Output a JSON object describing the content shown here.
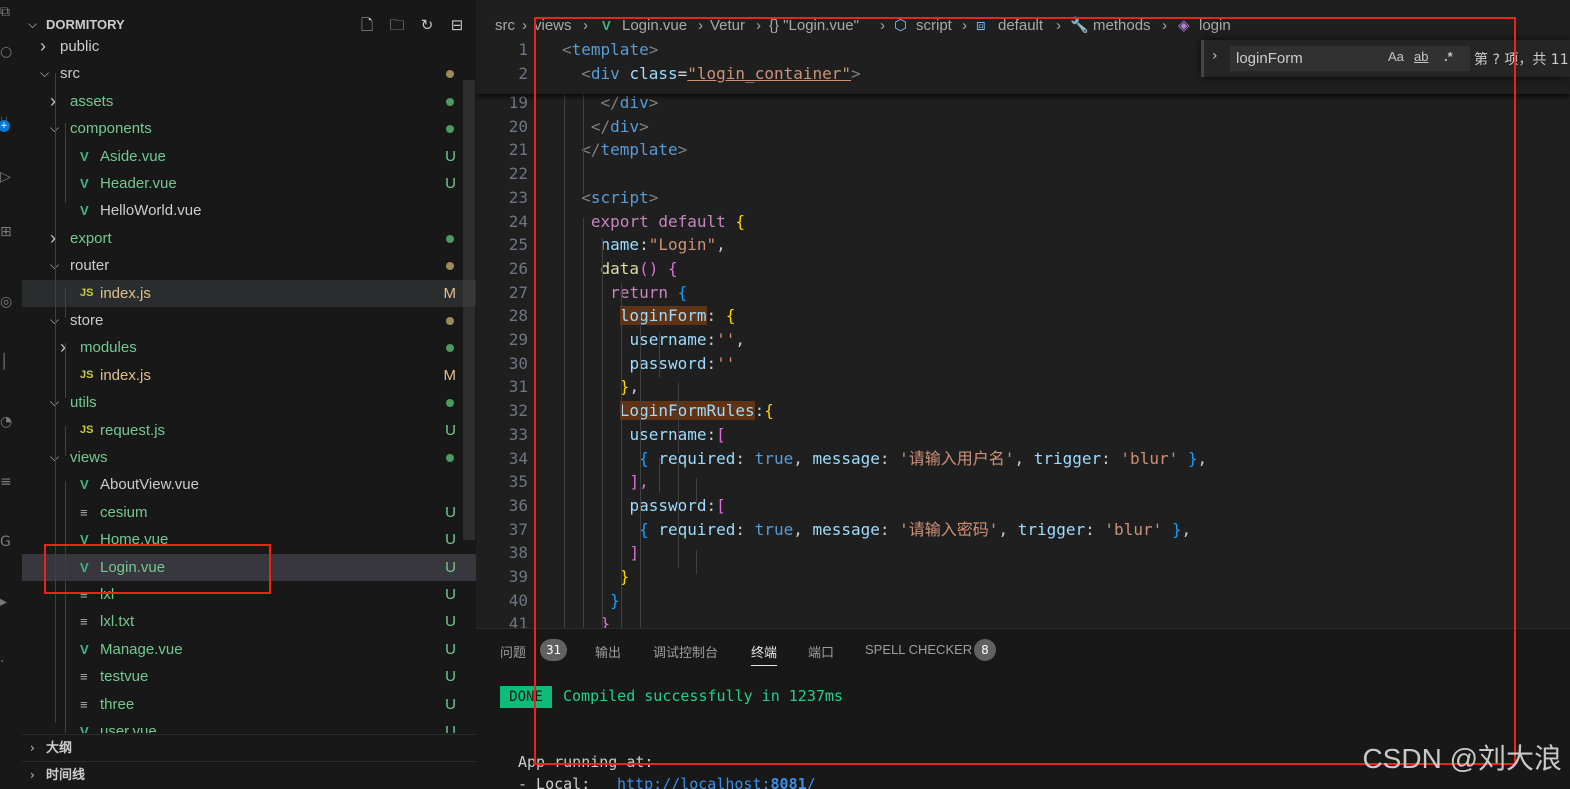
{
  "explorer": {
    "title": "DORMITORY",
    "items": [
      {
        "label": "public",
        "kind": "folder",
        "expanded": false,
        "depth": 1,
        "status": "",
        "color": "#cccccc"
      },
      {
        "label": "src",
        "kind": "folder",
        "expanded": true,
        "depth": 1,
        "status": "dot",
        "color": "#cccccc",
        "dot": "#9c8a5a"
      },
      {
        "label": "assets",
        "kind": "folder",
        "expanded": false,
        "depth": 2,
        "status": "dot",
        "color": "#73c991",
        "dot": "#4c9a5e"
      },
      {
        "label": "components",
        "kind": "folder",
        "expanded": true,
        "depth": 2,
        "status": "dot",
        "color": "#73c991",
        "dot": "#4c9a5e"
      },
      {
        "label": "Aside.vue",
        "kind": "vue",
        "depth": 3,
        "status": "U",
        "color": "#73c991"
      },
      {
        "label": "Header.vue",
        "kind": "vue",
        "depth": 3,
        "status": "U",
        "color": "#73c991"
      },
      {
        "label": "HelloWorld.vue",
        "kind": "vue",
        "depth": 3,
        "status": "",
        "color": "#cccccc"
      },
      {
        "label": "export",
        "kind": "folder",
        "expanded": false,
        "depth": 2,
        "status": "dot",
        "color": "#73c991",
        "dot": "#4c9a5e"
      },
      {
        "label": "router",
        "kind": "folder",
        "expanded": true,
        "depth": 2,
        "status": "dot",
        "color": "#cccccc",
        "dot": "#9c8a5a"
      },
      {
        "label": "index.js",
        "kind": "js",
        "depth": 3,
        "status": "M",
        "color": "#e2c08d",
        "hover": true
      },
      {
        "label": "store",
        "kind": "folder",
        "expanded": true,
        "depth": 2,
        "status": "dot",
        "color": "#cccccc",
        "dot": "#9c8a5a"
      },
      {
        "label": "modules",
        "kind": "folder",
        "expanded": false,
        "depth": 3,
        "status": "dot",
        "color": "#73c991",
        "dot": "#4c9a5e"
      },
      {
        "label": "index.js",
        "kind": "js",
        "depth": 3,
        "status": "M",
        "color": "#e2c08d"
      },
      {
        "label": "utils",
        "kind": "folder",
        "expanded": true,
        "depth": 2,
        "status": "dot",
        "color": "#73c991",
        "dot": "#4c9a5e"
      },
      {
        "label": "request.js",
        "kind": "js",
        "depth": 3,
        "status": "U",
        "color": "#73c991"
      },
      {
        "label": "views",
        "kind": "folder",
        "expanded": true,
        "depth": 2,
        "status": "dot",
        "color": "#73c991",
        "dot": "#4c9a5e"
      },
      {
        "label": "AboutView.vue",
        "kind": "vue",
        "depth": 3,
        "status": "",
        "color": "#cccccc"
      },
      {
        "label": "cesium",
        "kind": "txt",
        "depth": 3,
        "status": "U",
        "color": "#73c991"
      },
      {
        "label": "Home.vue",
        "kind": "vue",
        "depth": 3,
        "status": "U",
        "color": "#73c991"
      },
      {
        "label": "Login.vue",
        "kind": "vue",
        "depth": 3,
        "status": "U",
        "color": "#73c991",
        "selected": true
      },
      {
        "label": "lxl",
        "kind": "txt",
        "depth": 3,
        "status": "U",
        "color": "#73c991"
      },
      {
        "label": "lxl.txt",
        "kind": "txt",
        "depth": 3,
        "status": "U",
        "color": "#73c991"
      },
      {
        "label": "Manage.vue",
        "kind": "vue",
        "depth": 3,
        "status": "U",
        "color": "#73c991"
      },
      {
        "label": "testvue",
        "kind": "txt",
        "depth": 3,
        "status": "U",
        "color": "#73c991"
      },
      {
        "label": "three",
        "kind": "txt",
        "depth": 3,
        "status": "U",
        "color": "#73c991"
      },
      {
        "label": "user.vue",
        "kind": "vue",
        "depth": 3,
        "status": "U",
        "color": "#73c991"
      }
    ],
    "sections": [
      "大纲",
      "时间线"
    ]
  },
  "breadcrumb": [
    "src",
    "views",
    "Login.vue",
    "Vetur",
    "{} \"Login.vue\"",
    "script",
    "default",
    "methods",
    "login"
  ],
  "find": {
    "value": "loginForm",
    "case_label": "Aa",
    "word_label": "ab",
    "regex_label": ".*",
    "count": "第 ? 项，共 11"
  },
  "code": {
    "sticky": [
      {
        "n": "1",
        "indent": 0,
        "text": "<template>"
      },
      {
        "n": "2",
        "indent": 1,
        "text": "<div class=\"login_container\">"
      }
    ],
    "lines": [
      {
        "n": "19"
      },
      {
        "n": "20"
      },
      {
        "n": "21"
      },
      {
        "n": "22"
      },
      {
        "n": "23"
      },
      {
        "n": "24"
      },
      {
        "n": "25"
      },
      {
        "n": "26"
      },
      {
        "n": "27"
      },
      {
        "n": "28"
      },
      {
        "n": "29"
      },
      {
        "n": "30"
      },
      {
        "n": "31"
      },
      {
        "n": "32"
      },
      {
        "n": "33"
      },
      {
        "n": "34"
      },
      {
        "n": "35"
      },
      {
        "n": "36"
      },
      {
        "n": "37"
      },
      {
        "n": "38"
      },
      {
        "n": "39"
      },
      {
        "n": "40"
      },
      {
        "n": "41"
      }
    ],
    "tokens": {
      "div": "div",
      "template": "template",
      "script": "script",
      "class_attr": "class",
      "class_value": "\"login_container\"",
      "export": "export",
      "default": "default",
      "name_key": "name",
      "name_value": "\"Login\"",
      "data_fn": "data",
      "return": "return",
      "loginForm": "loginForm",
      "username": "username",
      "password": "password",
      "empty_str": "''",
      "rules": "LoginFormRules",
      "required": "required",
      "true": "true",
      "message": "message",
      "msg_user": "'请输入用户名'",
      "msg_pass": "'请输入密码'",
      "trigger": "trigger",
      "blur": "'blur'"
    }
  },
  "panel": {
    "tabs": [
      {
        "label": "问题",
        "badge": "31"
      },
      {
        "label": "输出"
      },
      {
        "label": "调试控制台"
      },
      {
        "label": "终端",
        "active": true
      },
      {
        "label": "端口"
      },
      {
        "label": "SPELL CHECKER",
        "badge": "8"
      }
    ],
    "terminal": {
      "done": "DONE",
      "compiled": "Compiled successfully in 1237ms",
      "running": "App running at:",
      "local_label": "- Local:",
      "local_url_prefix": "http://localhost:",
      "local_port": "8081",
      "local_url_suffix": "/"
    }
  },
  "watermark": "CSDN @刘大浪",
  "colors": {
    "annotation_red": "#e8241b",
    "git_untracked": "#73c991",
    "git_modified": "#e2c08d"
  }
}
